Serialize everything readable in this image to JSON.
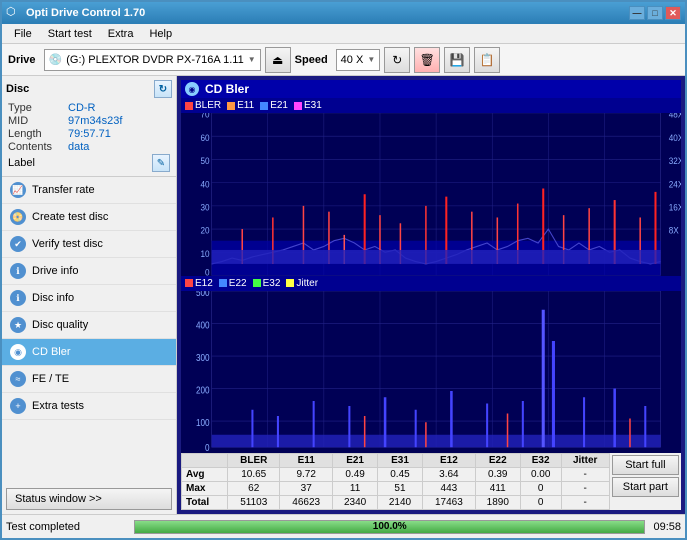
{
  "window": {
    "title": "Opti Drive Control 1.70",
    "min_btn": "—",
    "max_btn": "□",
    "close_btn": "✕"
  },
  "menu": {
    "items": [
      "File",
      "Start test",
      "Extra",
      "Help"
    ]
  },
  "toolbar": {
    "drive_label": "Drive",
    "drive_icon": "💿",
    "drive_value": "(G:)  PLEXTOR DVDR  PX-716A 1.11",
    "speed_label": "Speed",
    "speed_value": "40 X"
  },
  "disc": {
    "header": "Disc",
    "type_label": "Type",
    "type_value": "CD-R",
    "mid_label": "MID",
    "mid_value": "97m34s23f",
    "length_label": "Length",
    "length_value": "79:57.71",
    "contents_label": "Contents",
    "contents_value": "data",
    "label_label": "Label"
  },
  "nav": {
    "items": [
      {
        "id": "transfer-rate",
        "label": "Transfer rate",
        "active": false
      },
      {
        "id": "create-test-disc",
        "label": "Create test disc",
        "active": false
      },
      {
        "id": "verify-test-disc",
        "label": "Verify test disc",
        "active": false
      },
      {
        "id": "drive-info",
        "label": "Drive info",
        "active": false
      },
      {
        "id": "disc-info",
        "label": "Disc info",
        "active": false
      },
      {
        "id": "disc-quality",
        "label": "Disc quality",
        "active": false
      },
      {
        "id": "cd-bler",
        "label": "CD Bler",
        "active": true
      },
      {
        "id": "fe-te",
        "label": "FE / TE",
        "active": false
      },
      {
        "id": "extra-tests",
        "label": "Extra tests",
        "active": false
      }
    ],
    "status_btn": "Status window >>",
    "status_text": "Test completed"
  },
  "chart": {
    "title": "CD Bler",
    "top_legend": [
      {
        "label": "BLER",
        "color": "#ff4444"
      },
      {
        "label": "E11",
        "color": "#ff9944"
      },
      {
        "label": "E21",
        "color": "#4488ff"
      },
      {
        "label": "E31",
        "color": "#ff44ff"
      }
    ],
    "top_y_max": 70,
    "top_y_labels": [
      "70",
      "60",
      "50",
      "40",
      "30",
      "20",
      "10",
      "0"
    ],
    "top_y_right": [
      "48X",
      "40X",
      "32X",
      "24X",
      "16X",
      "8X"
    ],
    "x_max": 80,
    "bottom_legend": [
      {
        "label": "E12",
        "color": "#ff4444"
      },
      {
        "label": "E22",
        "color": "#4488ff"
      },
      {
        "label": "E32",
        "color": "#44ff44"
      },
      {
        "label": "Jitter",
        "color": "#ffff44"
      }
    ],
    "bottom_y_max": 500,
    "bottom_y_labels": [
      "500",
      "400",
      "300",
      "200",
      "100",
      "0"
    ]
  },
  "stats": {
    "headers": [
      "",
      "BLER",
      "E11",
      "E21",
      "E31",
      "E12",
      "E22",
      "E32",
      "Jitter"
    ],
    "avg": {
      "label": "Avg",
      "values": [
        "10.65",
        "9.72",
        "0.49",
        "0.45",
        "3.64",
        "0.39",
        "0.00",
        "-"
      ]
    },
    "max": {
      "label": "Max",
      "values": [
        "62",
        "37",
        "11",
        "51",
        "443",
        "411",
        "0",
        "-"
      ]
    },
    "total": {
      "label": "Total",
      "values": [
        "51103",
        "46623",
        "2340",
        "2140",
        "17463",
        "1890",
        "0",
        "-"
      ]
    }
  },
  "action_btns": {
    "start_full": "Start full",
    "start_part": "Start part"
  },
  "status_bar": {
    "test_completed": "Test completed",
    "progress": "100.0%",
    "time": "09:58"
  }
}
